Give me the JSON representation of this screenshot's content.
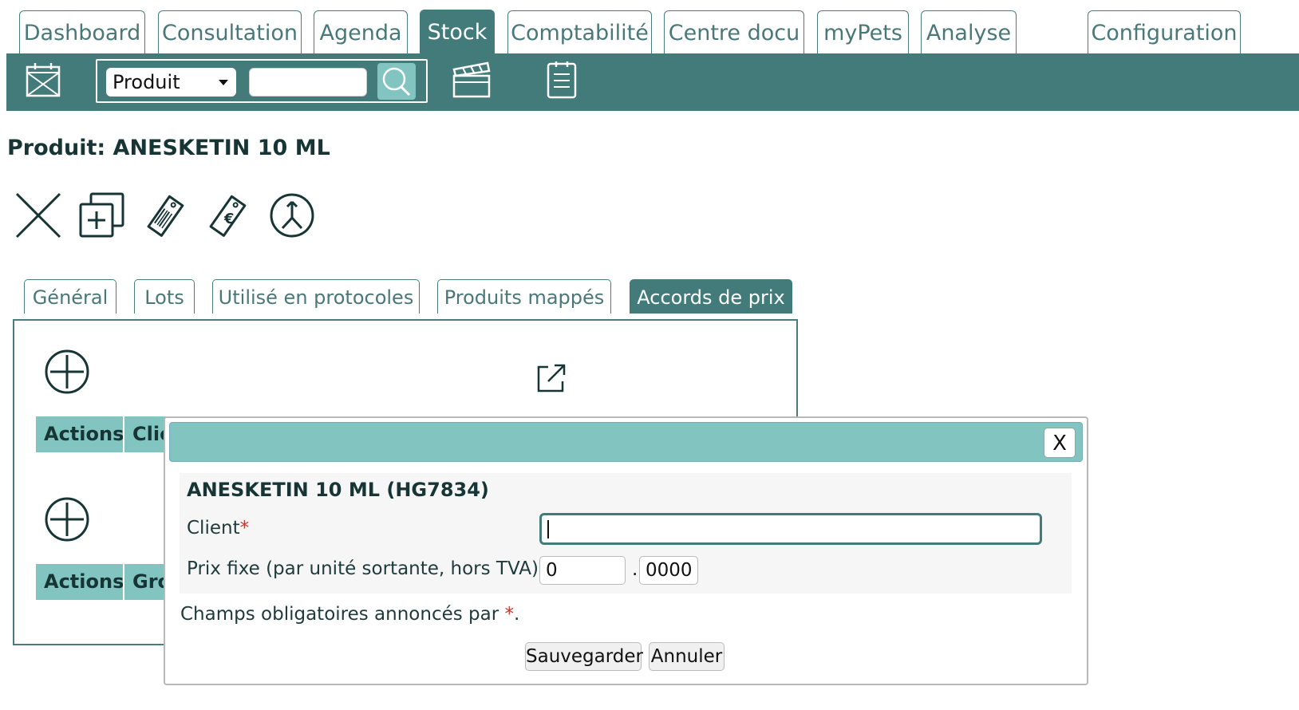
{
  "nav": {
    "tabs": [
      {
        "label": "Dashboard"
      },
      {
        "label": "Consultation"
      },
      {
        "label": "Agenda"
      },
      {
        "label": "Stock"
      },
      {
        "label": "Comptabilité"
      },
      {
        "label": "Centre docu"
      },
      {
        "label": "myPets"
      },
      {
        "label": "Analyse"
      },
      {
        "label": "Configuration"
      }
    ],
    "active": "Stock"
  },
  "toolbar": {
    "search_type": "Produit",
    "search_value": "",
    "icons": [
      "calendar-icon",
      "search-icon",
      "clapperboard-icon",
      "clipboard-icon"
    ]
  },
  "page": {
    "title": "Produit: ANESKETIN 10 ML"
  },
  "actions": {
    "icons": [
      "delete-icon",
      "duplicate-icon",
      "barcode-tag-icon",
      "euro-tag-icon",
      "merge-icon"
    ]
  },
  "subtabs": {
    "tabs": [
      {
        "label": "Général"
      },
      {
        "label": "Lots"
      },
      {
        "label": "Utilisé en protocoles"
      },
      {
        "label": "Produits mappés"
      },
      {
        "label": "Accords de prix"
      }
    ],
    "active": "Accords de prix"
  },
  "panel": {
    "table1": {
      "headers": [
        "Actions",
        "Clie"
      ]
    },
    "table2": {
      "headers": [
        "Actions",
        "Gro"
      ]
    }
  },
  "dialog": {
    "close_label": "X",
    "product": "ANESKETIN 10 ML (HG7834)",
    "client_label": "Client",
    "client_value": "",
    "price_label": "Prix fixe (par unité sortante, hors TVA)",
    "price_int": "0",
    "price_dec": "0000",
    "required_mark": "*",
    "required_note_prefix": "Champs obligatoires annoncés par ",
    "required_note_suffix": ".",
    "save_label": "Sauvegarder",
    "cancel_label": "Annuler"
  },
  "colors": {
    "primary": "#437b7b",
    "accent": "#82c4c0",
    "required": "#c0392b"
  }
}
